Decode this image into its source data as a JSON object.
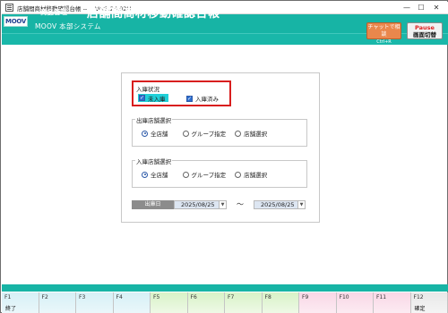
{
  "window": {
    "title": "店舗間商材移動確認台帳 -- -- Ver3.24.02H",
    "minimize": "—",
    "maximize": "☐",
    "close": "✕"
  },
  "header": {
    "logo": "MOOV",
    "module": "商品管理",
    "screen_title": "店舗間商材移動確認台帳",
    "system_name": "MOOV 本部システム",
    "chat_button": {
      "label": "チャットで相談",
      "sub": "Ctrl+R"
    },
    "pause_button": {
      "label_en": "Pause",
      "label_jp": "画面切替"
    }
  },
  "form": {
    "stock_status": {
      "label": "入庫状況",
      "options": [
        {
          "label": "未入庫",
          "checked": true,
          "highlighted": true
        },
        {
          "label": "入庫済み",
          "checked": true,
          "highlighted": false
        }
      ]
    },
    "from_store": {
      "label": "出庫店舗選択",
      "options": [
        "全店舗",
        "グループ指定",
        "店舗選択"
      ],
      "selected": "全店舗"
    },
    "to_store": {
      "label": "入庫店舗選択",
      "options": [
        "全店舗",
        "グループ指定",
        "店舗選択"
      ],
      "selected": "全店舗"
    },
    "date": {
      "label": "出庫日",
      "from": "2025/08/25",
      "separator": "～",
      "to": "2025/08/25"
    }
  },
  "function_keys": [
    {
      "key": "F1",
      "label": "終了",
      "color": "blue"
    },
    {
      "key": "F2",
      "label": "",
      "color": "blue"
    },
    {
      "key": "F3",
      "label": "",
      "color": "blue"
    },
    {
      "key": "F4",
      "label": "",
      "color": "blue"
    },
    {
      "key": "F5",
      "label": "",
      "color": "green"
    },
    {
      "key": "F6",
      "label": "",
      "color": "green"
    },
    {
      "key": "F7",
      "label": "",
      "color": "green"
    },
    {
      "key": "F8",
      "label": "",
      "color": "green"
    },
    {
      "key": "F9",
      "label": "",
      "color": "pink"
    },
    {
      "key": "F10",
      "label": "",
      "color": "pink"
    },
    {
      "key": "F11",
      "label": "",
      "color": "pink"
    },
    {
      "key": "F12",
      "label": "確定",
      "color": "gray"
    }
  ],
  "colors": {
    "header": "#17b4a5",
    "highlight_box": "#d81e1e",
    "checkbox_highlight": "#20d0d8"
  }
}
